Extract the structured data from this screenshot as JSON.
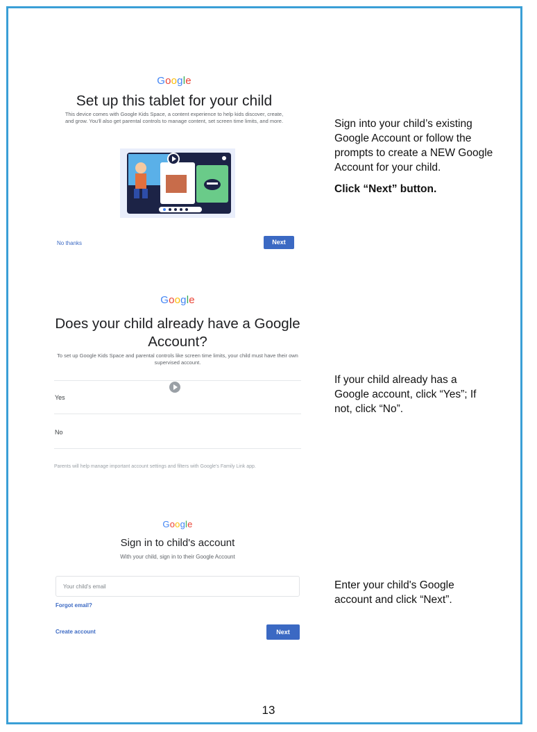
{
  "page_number": "13",
  "google_logo": "Google",
  "step1": {
    "title": "Set up this tablet for your child",
    "description": "This device comes with Google Kids Space, a content experience to help kids discover, create, and grow. You'll also get parental controls to manage content, set screen time limits, and more.",
    "no_thanks": "No thanks",
    "next": "Next",
    "instructions": [
      "Sign into your child’s existing Google Account or follow the prompts to create a NEW Google Account for your child.",
      "Click “Next” button."
    ]
  },
  "step2": {
    "title": "Does your child already have a Google Account?",
    "description": "To set up Google Kids Space and parental controls like screen time limits, your child must have their own supervised account.",
    "options": [
      "Yes",
      "No"
    ],
    "footer": "Parents will help manage important account settings and filters with Google's Family Link app.",
    "instructions": [
      "If your child already has a Google account, click “Yes”; If not, click “No”."
    ]
  },
  "step3": {
    "title": "Sign in to child's account",
    "description": "With your child, sign in to their Google Account",
    "email_placeholder": "Your child's email",
    "forgot_email": "Forgot email?",
    "create_account": "Create account",
    "next": "Next",
    "instructions": [
      "Enter your child's Google account and click “Next”."
    ]
  },
  "colors": {
    "frame": "#3a9fd6",
    "button": "#3b69c3"
  }
}
